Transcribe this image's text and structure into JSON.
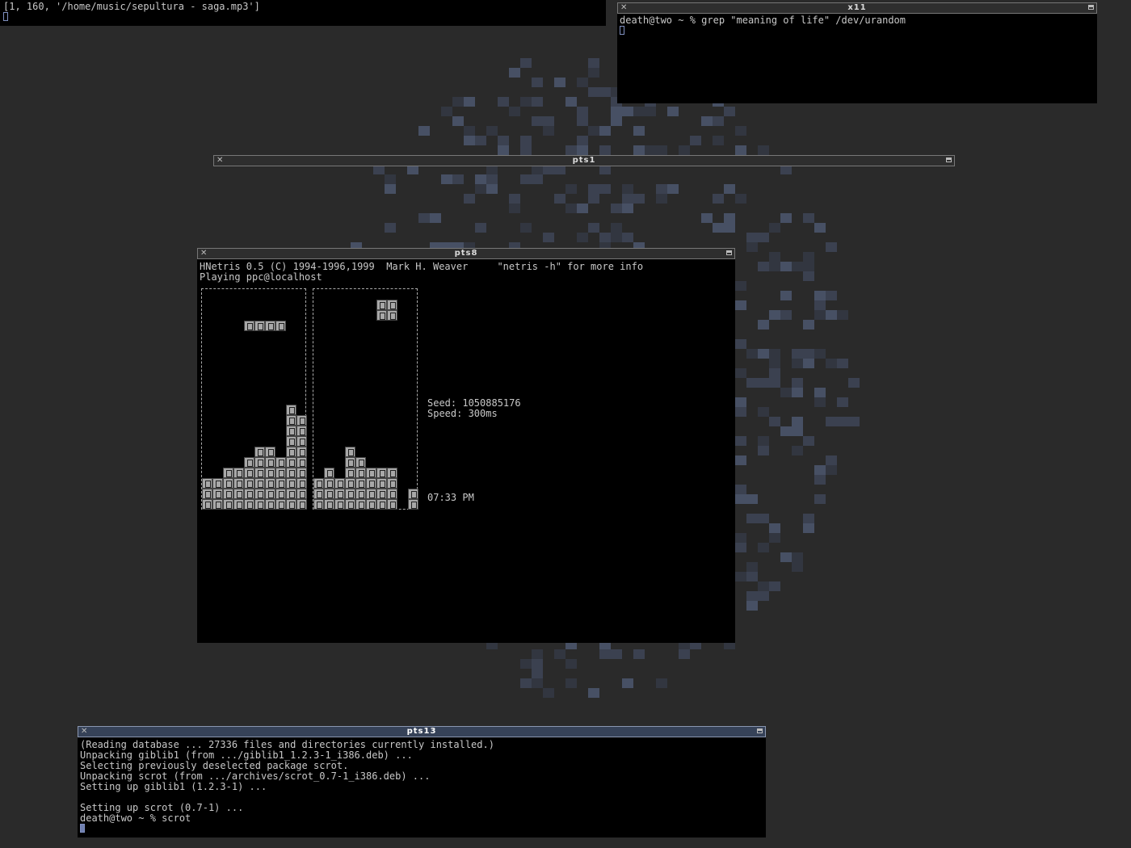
{
  "top_bar": {
    "text": "[1, 160, '/home/music/sepultura - saga.mp3']"
  },
  "windows": {
    "x11": {
      "title": "x11",
      "line1": "death@two ~ % grep \"meaning of life\" /dev/urandom"
    },
    "pts1": {
      "title": "pts1"
    },
    "pts8": {
      "title": "pts8",
      "header1": "HNetris 0.5 (C) 1994-1996,1999  Mark H. Weaver     \"netris -h\" for more info",
      "header2": "Playing ppc@localhost",
      "seed": "Seed: 1050885176",
      "speed": "Speed: 300ms",
      "time": "07:33 PM",
      "left_board": {
        "piece": [
          [
            4,
            3
          ],
          [
            5,
            3
          ],
          [
            6,
            3
          ],
          [
            7,
            3
          ]
        ],
        "heights": [
          3,
          3,
          4,
          4,
          5,
          6,
          6,
          5,
          10,
          9
        ]
      },
      "right_board": {
        "piece": [
          [
            6,
            1
          ],
          [
            7,
            1
          ],
          [
            6,
            2
          ],
          [
            7,
            2
          ]
        ],
        "heights": [
          3,
          4,
          3,
          6,
          5,
          4,
          4,
          4,
          0,
          2
        ]
      }
    },
    "pts13": {
      "title": "pts13",
      "lines": [
        "(Reading database ... 27336 files and directories currently installed.)",
        "Unpacking giblib1 (from .../giblib1_1.2.3-1_i386.deb) ...",
        "Selecting previously deselected package scrot.",
        "Unpacking scrot (from .../archives/scrot_0.7-1_i386.deb) ...",
        "Setting up giblib1 (1.2.3-1) ...",
        "",
        "Setting up scrot (0.7-1) ...",
        "death@two ~ % scrot"
      ]
    }
  },
  "icons": {
    "close": "close-icon",
    "maximize": "maximize-icon"
  }
}
